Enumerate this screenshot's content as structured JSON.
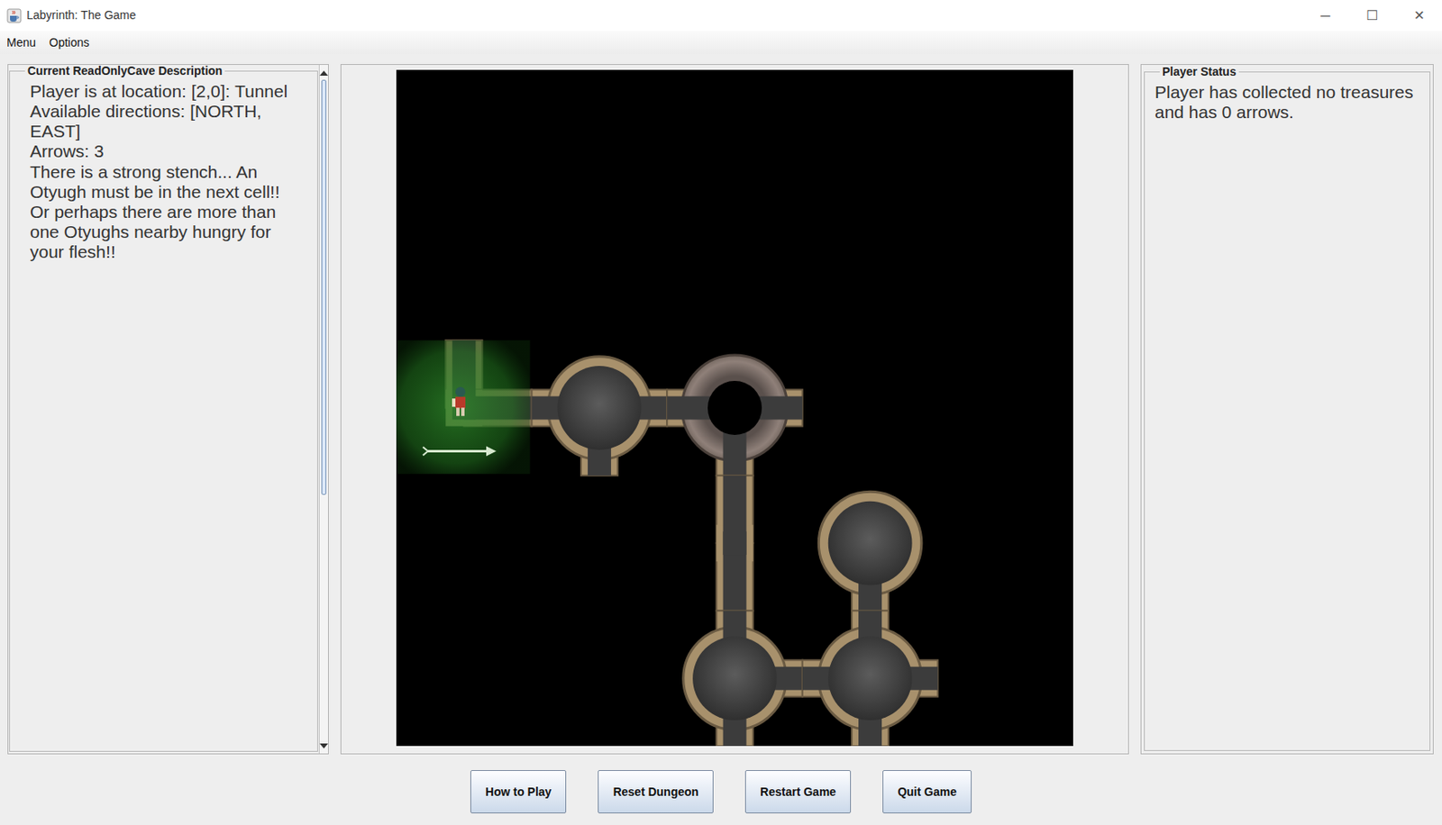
{
  "window": {
    "title": "Labyrinth: The Game",
    "controls": [
      "─",
      "☐",
      "✕"
    ]
  },
  "menu": [
    {
      "label": "Menu"
    },
    {
      "label": "Options"
    }
  ],
  "description": {
    "title": "Current ReadOnlyCave Description",
    "lines": [
      "Player is at location: [2,0]: Tunnel",
      "Available directions: [NORTH, EAST]",
      "Arrows: 3",
      "There is a strong stench... An Otyugh must be in the next cell!! Or perhaps there are more than one Otyughs nearby hungry for your flesh!!"
    ],
    "scrollbar": {
      "level": 0.63
    }
  },
  "map": {
    "cells": [
      {
        "row": 2,
        "col": 0,
        "kind": "tunnel",
        "exits": [
          "N",
          "E"
        ],
        "stench": true,
        "arrows": true,
        "player": true
      },
      {
        "row": 2,
        "col": 1,
        "kind": "cave",
        "exits": [
          "W",
          "E",
          "S"
        ],
        "stench": false,
        "arrows": false,
        "player": false
      },
      {
        "row": 2,
        "col": 2,
        "kind": "rubble",
        "exits": [
          "W",
          "E",
          "S"
        ],
        "stench": false,
        "arrows": false,
        "player": false
      },
      {
        "row": 3,
        "col": 2,
        "kind": "tunnel",
        "exits": [
          "N",
          "S"
        ],
        "stench": false,
        "arrows": false,
        "player": false
      },
      {
        "row": 3,
        "col": 3,
        "kind": "cave",
        "exits": [
          "S"
        ],
        "stench": false,
        "arrows": false,
        "player": false
      },
      {
        "row": 4,
        "col": 2,
        "kind": "cave",
        "exits": [
          "N",
          "E",
          "S"
        ],
        "stench": false,
        "arrows": false,
        "player": false
      },
      {
        "row": 4,
        "col": 3,
        "kind": "cave",
        "exits": [
          "W",
          "N",
          "E",
          "S"
        ],
        "stench": false,
        "arrows": false,
        "player": false
      }
    ]
  },
  "status": {
    "title": "Player Status",
    "text": "Player has collected no treasures and has 0 arrows."
  },
  "buttons": [
    "How to Play",
    "Reset Dungeon",
    "Restart Game",
    "Quit Game"
  ]
}
